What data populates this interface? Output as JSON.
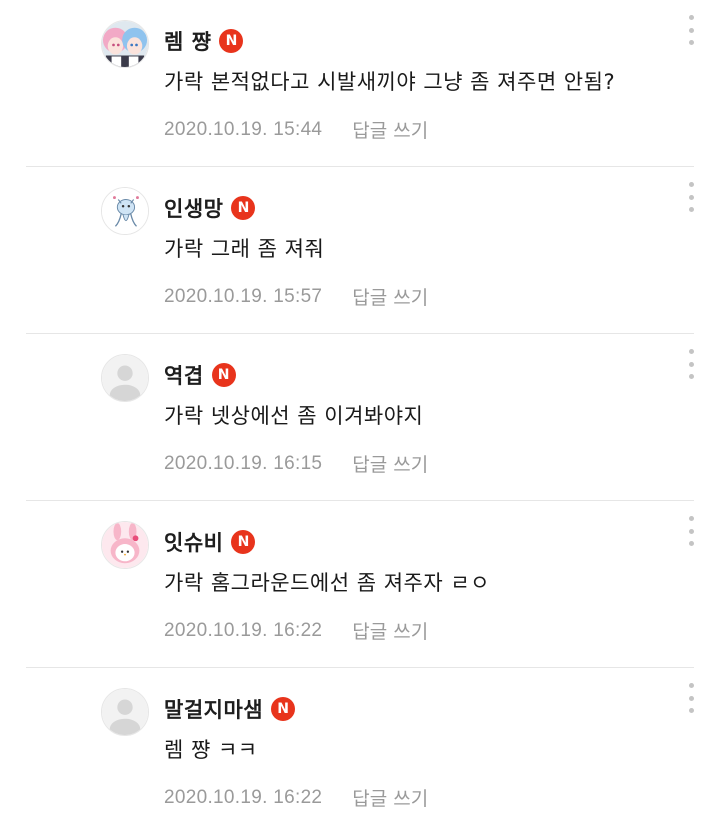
{
  "reply_label": "답글 쓰기",
  "badge_label": "N",
  "comments": [
    {
      "nickname": "렘 쨩",
      "text": "가락 본적없다고 시발새끼야 그냥 좀 져주면 안됨?",
      "date": "2020.10.19. 15:44",
      "avatar": "anime-twins-avatar"
    },
    {
      "nickname": "인생망",
      "text": "가락 그래 좀 져줘",
      "date": "2020.10.19. 15:57",
      "avatar": "cartoon-creature-avatar"
    },
    {
      "nickname": "역겹",
      "text": "가락 넷상에선 좀 이겨봐야지",
      "date": "2020.10.19. 16:15",
      "avatar": "default-avatar"
    },
    {
      "nickname": "잇슈비",
      "text": "가락 홈그라운드에선 좀 져주자 ㄹㅇ",
      "date": "2020.10.19. 16:22",
      "avatar": "pink-bunny-avatar"
    },
    {
      "nickname": "말걸지마샘",
      "text": "렘 쨩 ㅋㅋ",
      "date": "2020.10.19. 16:22",
      "avatar": "default-avatar"
    }
  ],
  "colors": {
    "badge": "#e8341c",
    "meta_text": "#9a9a9a",
    "divider": "#e6e6e6"
  }
}
